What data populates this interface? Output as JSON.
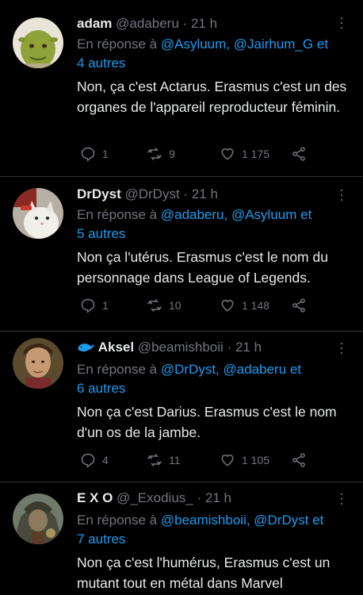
{
  "tweets": [
    {
      "name": "adam",
      "handle": "@adaberu",
      "dot": "·",
      "time": "21 h",
      "reply_prefix": "En réponse à ",
      "reply_mentions": "@Asyluum, @Jairhum_G",
      "reply_and": " et ",
      "reply_others": "4 autres",
      "text": "Non, ça c'est Actarus. Erasmus c'est un des organes de l'appareil reproducteur féminin.",
      "replies": "1",
      "retweets": "9",
      "likes": "1 175"
    },
    {
      "name": "DrDyst",
      "handle": "@DrDyst",
      "dot": "·",
      "time": "21 h",
      "reply_prefix": "En réponse à ",
      "reply_mentions": "@adaberu, @Asyluum",
      "reply_and": " et ",
      "reply_others": "5 autres",
      "text": "Non ça l'utérus. Erasmus c'est le nom du personnage dans League of Legends.",
      "replies": "1",
      "retweets": "10",
      "likes": "1 148"
    },
    {
      "name": "Aksel",
      "handle": "@beamishboii",
      "dot": "·",
      "time": "21 h",
      "reply_prefix": "En réponse à ",
      "reply_mentions": "@DrDyst, @adaberu",
      "reply_and": " et ",
      "reply_others": "6 autres",
      "text": "Non ça c'est Darius. Erasmus c'est le nom d'un os de la jambe.",
      "replies": "4",
      "retweets": "11",
      "likes": "1 105"
    },
    {
      "name": "E X O",
      "handle": "@_Exodius_",
      "dot": "·",
      "time": "21 h",
      "reply_prefix": "En réponse à ",
      "reply_mentions": "@beamishboii, @DrDyst",
      "reply_and": " et ",
      "reply_others": "7 autres",
      "text": "Non ça c'est l'humérus, Erasmus c'est un mutant tout en métal dans Marvel"
    }
  ],
  "icons": {
    "reply": "reply-icon",
    "retweet": "retweet-icon",
    "like": "heart-icon",
    "share": "share-icon",
    "more": "more-icon",
    "whale": "whale-emoji-icon"
  },
  "colors": {
    "background": "#000000",
    "text": "#e7e9ea",
    "muted": "#71767b",
    "accent": "#1d9bf0"
  }
}
